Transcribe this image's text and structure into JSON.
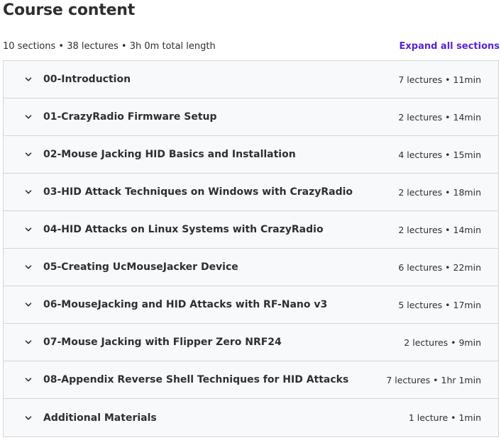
{
  "header": {
    "title": "Course content",
    "summary": "10 sections • 38 lectures • 3h 0m total length",
    "expand_all_label": "Expand all sections"
  },
  "icons": {
    "section_toggle": "chevron-down-icon"
  },
  "colors": {
    "accent": "#5624d0",
    "text": "#2d2f31",
    "section_bg": "#f7f9fa",
    "border": "#d1d7dc"
  },
  "sections": [
    {
      "title": "00-Introduction",
      "stats": "7 lectures • 11min"
    },
    {
      "title": "01-CrazyRadio Firmware Setup",
      "stats": "2 lectures • 14min"
    },
    {
      "title": "02-Mouse Jacking HID Basics and Installation",
      "stats": "4 lectures • 15min"
    },
    {
      "title": "03-HID Attack Techniques on Windows with CrazyRadio",
      "stats": "2 lectures • 18min"
    },
    {
      "title": "04-HID Attacks on Linux Systems with CrazyRadio",
      "stats": "2 lectures • 14min"
    },
    {
      "title": "05-Creating UcMouseJacker Device",
      "stats": "6 lectures • 22min"
    },
    {
      "title": "06-MouseJacking and HID Attacks with RF-Nano v3",
      "stats": "5 lectures • 17min"
    },
    {
      "title": "07-Mouse Jacking with Flipper Zero NRF24",
      "stats": "2 lectures • 9min"
    },
    {
      "title": "08-Appendix Reverse Shell Techniques for HID Attacks",
      "stats": "7 lectures • 1hr 1min"
    },
    {
      "title": "Additional Materials",
      "stats": "1 lecture • 1min"
    }
  ]
}
